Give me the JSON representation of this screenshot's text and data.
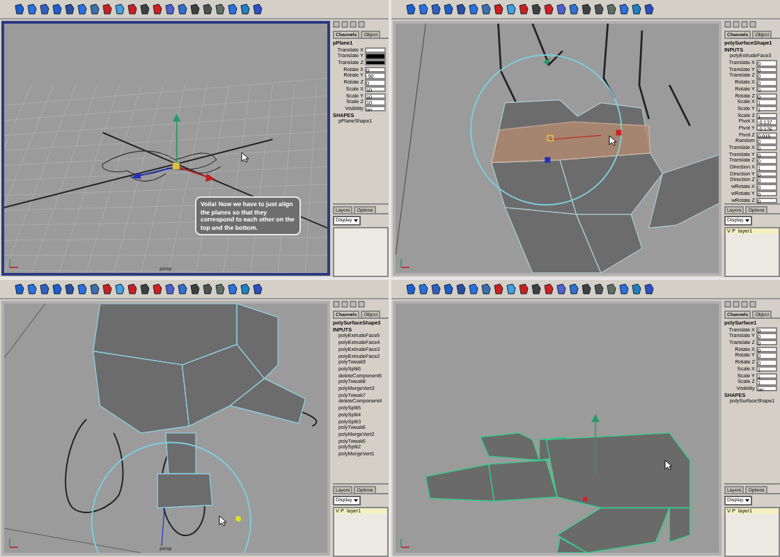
{
  "panels": [
    {
      "active": true,
      "viewport": {
        "kind": "grid",
        "camera": "persp",
        "callout": "Voila! Now we have to just align the planes so that they correspond to each other on the top and the bottom."
      },
      "channel_box": {
        "tabs": [
          {
            "label": "Channels",
            "selected": true
          },
          {
            "label": "Object",
            "selected": false
          }
        ],
        "lines": [
          {
            "kind": "node",
            "text": "pPlane1"
          },
          {
            "kind": "attr",
            "name": "Translate X",
            "selected": false
          },
          {
            "kind": "attr",
            "name": "Translate Y",
            "selected": true
          },
          {
            "kind": "attr",
            "name": "Translate Z",
            "selected": true
          },
          {
            "kind": "attr",
            "name": "Rotate X",
            "value": "0",
            "selected": false
          },
          {
            "kind": "attr",
            "name": "Rotate Y",
            "value": "-90",
            "selected": false
          },
          {
            "kind": "attr",
            "name": "Rotate Z",
            "value": "0",
            "selected": false
          },
          {
            "kind": "attr",
            "name": "Scale X",
            "value": "10",
            "selected": false
          },
          {
            "kind": "attr",
            "name": "Scale Y",
            "value": "10",
            "selected": false
          },
          {
            "kind": "attr",
            "name": "Scale Z",
            "value": "10",
            "selected": false
          },
          {
            "kind": "attr",
            "name": "Visibility",
            "value": "on",
            "selected": false
          },
          {
            "kind": "header",
            "text": "SHAPES"
          },
          {
            "kind": "item",
            "text": "pPlaneShape1"
          }
        ]
      },
      "layers": {
        "tabs": [
          "Layers",
          "Options"
        ],
        "display": "Display"
      }
    },
    {
      "active": false,
      "viewport": {
        "kind": "palm"
      },
      "channel_box": {
        "tabs": [
          {
            "label": "Channels",
            "selected": true
          },
          {
            "label": "Object",
            "selected": false
          }
        ],
        "lines": [
          {
            "kind": "node",
            "text": "polySurfaceShape1"
          },
          {
            "kind": "header",
            "text": "INPUTS"
          },
          {
            "kind": "item",
            "text": "polyExtrudeFace3"
          },
          {
            "kind": "attr",
            "name": "Translate X",
            "value": "0",
            "selected": false
          },
          {
            "kind": "attr",
            "name": "Translate Y",
            "value": "0",
            "selected": false
          },
          {
            "kind": "attr",
            "name": "Translate Z",
            "value": "0",
            "selected": false
          },
          {
            "kind": "attr",
            "name": "Rotate X",
            "value": "0",
            "selected": false
          },
          {
            "kind": "attr",
            "name": "Rotate Y",
            "value": "0",
            "selected": false
          },
          {
            "kind": "attr",
            "name": "Rotate Z",
            "value": "0",
            "selected": false
          },
          {
            "kind": "attr",
            "name": "Scale X",
            "value": "1",
            "selected": false
          },
          {
            "kind": "attr",
            "name": "Scale Y",
            "value": "1",
            "selected": false
          },
          {
            "kind": "attr",
            "name": "Scale Z",
            "value": "1",
            "selected": false
          },
          {
            "kind": "attr",
            "name": "Pivot X",
            "value": "-0.137",
            "selected": false
          },
          {
            "kind": "attr",
            "name": "Pivot Y",
            "value": "-0.176",
            "selected": false
          },
          {
            "kind": "attr",
            "name": "Pivot Z",
            "value": "0.015",
            "selected": false
          },
          {
            "kind": "attr",
            "name": "Random",
            "value": "0",
            "selected": false
          },
          {
            "kind": "attr",
            "name": "Translate X",
            "value": "0",
            "selected": false
          },
          {
            "kind": "attr",
            "name": "Translate Y",
            "value": "0",
            "selected": false
          },
          {
            "kind": "attr",
            "name": "Translate Z",
            "value": "0",
            "selected": false
          },
          {
            "kind": "attr",
            "name": "Direction X",
            "value": "1",
            "selected": false
          },
          {
            "kind": "attr",
            "name": "Direction Y",
            "value": "0",
            "selected": false
          },
          {
            "kind": "attr",
            "name": "Direction Z",
            "value": "0",
            "selected": false
          },
          {
            "kind": "attr",
            "name": "wRotate X",
            "value": "0",
            "selected": false
          },
          {
            "kind": "attr",
            "name": "wRotate Y",
            "value": "0",
            "selected": false
          },
          {
            "kind": "attr",
            "name": "wRotate Z",
            "value": "0",
            "selected": false
          }
        ]
      },
      "layers": {
        "tabs": [
          "Layers",
          "Options"
        ],
        "display": "Display",
        "rows": [
          {
            "flags": "V P",
            "name": "layer1"
          }
        ]
      }
    },
    {
      "active": false,
      "viewport": {
        "kind": "wrist",
        "camera": "persp"
      },
      "channel_box": {
        "tabs": [
          {
            "label": "Channels",
            "selected": true
          },
          {
            "label": "Object",
            "selected": false
          }
        ],
        "lines": [
          {
            "kind": "node",
            "text": "polySurfaceShape3"
          },
          {
            "kind": "header",
            "text": "INPUTS"
          },
          {
            "kind": "item",
            "text": "polyExtrudeFace5"
          },
          {
            "kind": "item",
            "text": "polyExtrudeFace4"
          },
          {
            "kind": "item",
            "text": "polyExtrudeFace3"
          },
          {
            "kind": "item",
            "text": "polyExtrudeFace2"
          },
          {
            "kind": "item",
            "text": "polyTweak9"
          },
          {
            "kind": "item",
            "text": "polySplit6"
          },
          {
            "kind": "item",
            "text": "deleteComponent5"
          },
          {
            "kind": "item",
            "text": "polyTweak8"
          },
          {
            "kind": "item",
            "text": "polyMergeVert3"
          },
          {
            "kind": "item",
            "text": "polyTweak7"
          },
          {
            "kind": "item",
            "text": "deleteComponent4"
          },
          {
            "kind": "item",
            "text": "polySplit5"
          },
          {
            "kind": "item",
            "text": "polySplit4"
          },
          {
            "kind": "item",
            "text": "polySplit3"
          },
          {
            "kind": "item",
            "text": "polyTweak6"
          },
          {
            "kind": "item",
            "text": "polyMergeVert2"
          },
          {
            "kind": "item",
            "text": "polyTweak5"
          },
          {
            "kind": "item",
            "text": "polySplit2"
          },
          {
            "kind": "item",
            "text": "polyMergeVert1"
          }
        ]
      },
      "layers": {
        "tabs": [
          "Layers",
          "Options"
        ],
        "display": "Display",
        "rows": [
          {
            "flags": "V P",
            "name": "layer1"
          }
        ]
      }
    },
    {
      "active": false,
      "viewport": {
        "kind": "side"
      },
      "channel_box": {
        "tabs": [
          {
            "label": "Channels",
            "selected": true
          },
          {
            "label": "Object",
            "selected": false
          }
        ],
        "lines": [
          {
            "kind": "node",
            "text": "polySurface1"
          },
          {
            "kind": "attr",
            "name": "Translate X",
            "value": "0",
            "selected": false
          },
          {
            "kind": "attr",
            "name": "Translate Y",
            "value": "0",
            "selected": false
          },
          {
            "kind": "attr",
            "name": "Translate Z",
            "value": "0",
            "selected": false
          },
          {
            "kind": "attr",
            "name": "Rotate X",
            "value": "0",
            "selected": false
          },
          {
            "kind": "attr",
            "name": "Rotate Y",
            "value": "0",
            "selected": false
          },
          {
            "kind": "attr",
            "name": "Rotate Z",
            "value": "0",
            "selected": false
          },
          {
            "kind": "attr",
            "name": "Scale X",
            "value": "1",
            "selected": false
          },
          {
            "kind": "attr",
            "name": "Scale Y",
            "value": "1",
            "selected": false
          },
          {
            "kind": "attr",
            "name": "Scale Z",
            "value": "1",
            "selected": false
          },
          {
            "kind": "attr",
            "name": "Visibility",
            "value": "on",
            "selected": false
          },
          {
            "kind": "header",
            "text": "SHAPES"
          },
          {
            "kind": "item",
            "text": "polySurfaceShape1"
          }
        ]
      },
      "layers": {
        "tabs": [
          "Layers",
          "Options"
        ],
        "display": "Display",
        "rows": [
          {
            "flags": "V P",
            "name": "layer1"
          }
        ]
      }
    }
  ]
}
